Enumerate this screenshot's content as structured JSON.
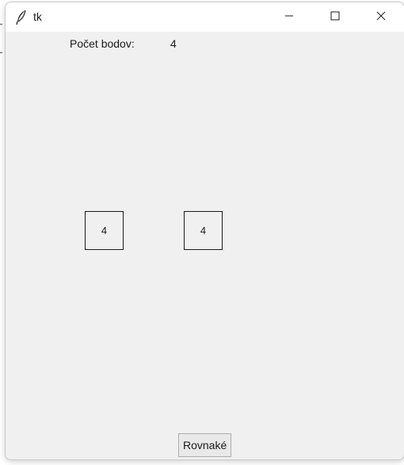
{
  "window": {
    "title": "tk",
    "icons": {
      "app": "feather-icon",
      "minimize": "minimize-icon",
      "maximize": "maximize-icon",
      "close": "close-icon"
    }
  },
  "score": {
    "label": "Počet bodov:",
    "value": "4"
  },
  "boxes": [
    {
      "value": "4"
    },
    {
      "value": "4"
    }
  ],
  "actions": {
    "equal_label": "Rovnaké"
  }
}
